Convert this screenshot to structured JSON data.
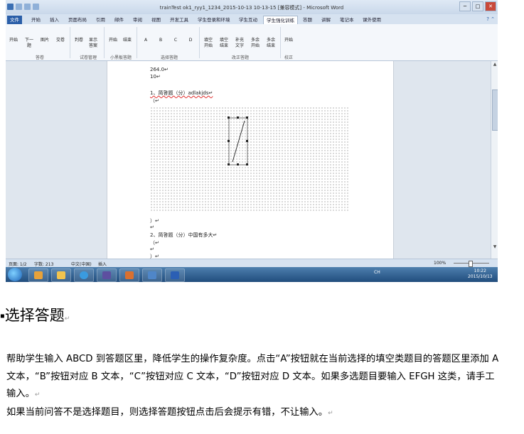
{
  "titlebar": {
    "title": "trainTest ok1_ryy1_1234_2015-10-13 10-13-15 [兼容模式] - Microsoft Word",
    "min": "─",
    "max": "□",
    "close": "✕"
  },
  "tabs": [
    "文件",
    "开始",
    "插入",
    "页面布局",
    "引用",
    "邮件",
    "审阅",
    "视图",
    "开发工具",
    "学生登录和环境",
    "学生互动",
    "学生强化训练",
    "答题",
    "讲解",
    "笔记本",
    "课外使用"
  ],
  "ribbon": {
    "buttons": [
      {
        "label": "开始"
      },
      {
        "label": "下一题"
      },
      {
        "label": "图片"
      },
      {
        "label": "交卷"
      },
      {
        "label": "判卷"
      },
      {
        "label": "显示答案"
      },
      {
        "label": "开始"
      },
      {
        "label": "结束"
      },
      {
        "label": "A"
      },
      {
        "label": "B"
      },
      {
        "label": "C"
      },
      {
        "label": "D"
      },
      {
        "label": "填空开始"
      },
      {
        "label": "填空结束"
      },
      {
        "label": "补充文字"
      },
      {
        "label": "多余开始"
      },
      {
        "label": "多余结束"
      },
      {
        "label": "开始"
      }
    ],
    "groups": [
      "答卷",
      "试卷管理",
      "小黑板答题",
      "选择答题",
      "改正答题",
      "校正"
    ]
  },
  "document": {
    "lines": [
      "264.0↵",
      "10↵",
      "1、简答题（分）adlakjds↵",
      "（↵",
      "）↵",
      "↵",
      "2、简答题（分）中国有多大↵",
      "（↵",
      "↵",
      "）↵"
    ]
  },
  "statusbar": {
    "page": "页面: 1/2",
    "words": "字数: 213",
    "lang": "中文(中国)",
    "mode": "插入",
    "zoom": "100%"
  },
  "taskbar": {
    "tray": "CH",
    "time": "10:22",
    "date": "2015/10/13"
  },
  "section": {
    "title": "选择答题",
    "para1": "帮助学生输入 ABCD 到答题区里，降低学生的操作复杂度。点击“A”按钮就在当前选择的填空类题目的答题区里添加 A 文本，“B”按钮对应 B 文本，“C”按钮对应 C 文本，“D”按钮对应 D 文本。如果多选题目要输入 EFGH 这类，请手工输入。",
    "para2": "如果当前问答不是选择题目，则选择答题按钮点击后会提示有错，不让输入。",
    "mark": "↵"
  }
}
